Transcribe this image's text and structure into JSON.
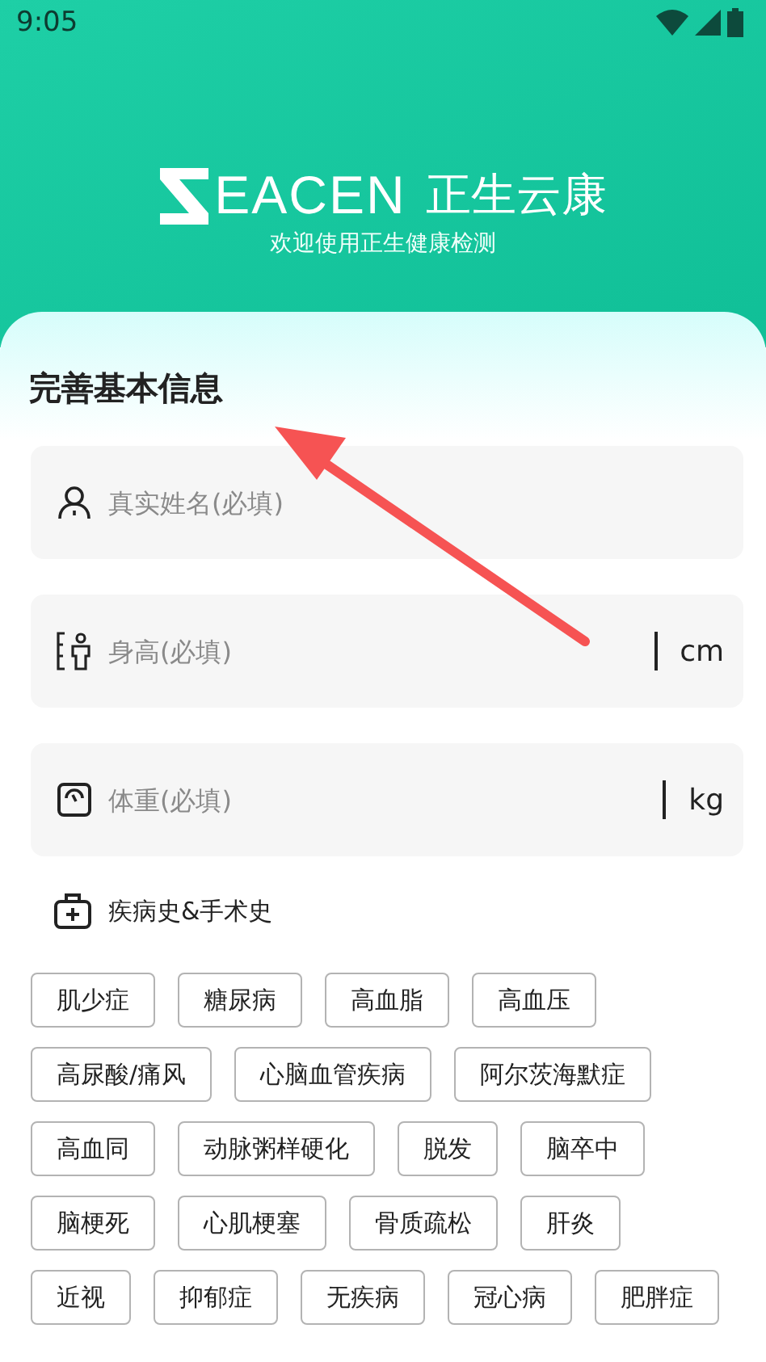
{
  "status_bar": {
    "time": "9:05"
  },
  "header": {
    "brand": "EACEN",
    "brand_cn": "正生云康",
    "welcome": "欢迎使用正生健康检测"
  },
  "form": {
    "title": "完善基本信息",
    "fields": [
      {
        "kind": "name",
        "placeholder": "真实姓名(必填)"
      },
      {
        "kind": "height",
        "placeholder": "身高(必填)",
        "unit": "cm"
      },
      {
        "kind": "weight",
        "placeholder": "体重(必填)",
        "unit": "kg"
      }
    ],
    "history_label": "疾病史&手术史",
    "tags": [
      "肌少症",
      "糖尿病",
      "高血脂",
      "高血压",
      "高尿酸/痛风",
      "心脑血管疾病",
      "阿尔茨海默症",
      "高血同",
      "动脉粥样硬化",
      "脱发",
      "脑卒中",
      "脑梗死",
      "心肌梗塞",
      "骨质疏松",
      "肝炎",
      "近视",
      "抑郁症",
      "无疾病",
      "冠心病",
      "肥胖症"
    ]
  }
}
